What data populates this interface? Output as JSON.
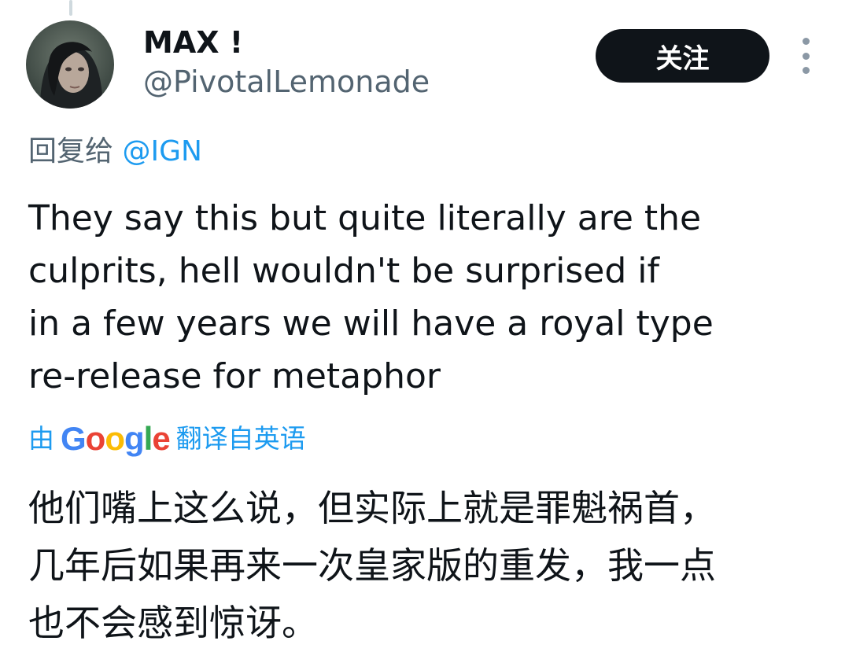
{
  "author": {
    "display_name": "MAX !",
    "handle": "@PivotalLemonade"
  },
  "actions": {
    "follow_label": "关注"
  },
  "reply_context": {
    "prefix": "回复给",
    "mention": "@IGN"
  },
  "tweet": {
    "lines": [
      "They say this but quite literally are the",
      "culprits, hell wouldn't be surprised if",
      "in a few years we will have a royal type",
      "re-release for metaphor"
    ]
  },
  "translation": {
    "by_prefix": "由",
    "provider_letters": [
      "G",
      "o",
      "o",
      "g",
      "l",
      "e"
    ],
    "by_suffix": "翻译自英语",
    "lines": [
      "他们嘴上这么说，但实际上就是罪魁祸首，",
      "几年后如果再来一次皇家版的重发，我一点",
      "也不会感到惊讶。"
    ]
  },
  "icons": {
    "more": "more-vertical-icon",
    "avatar": "user-avatar"
  },
  "colors": {
    "link_blue": "#1d9bf0",
    "secondary_text": "#536471",
    "follow_button_bg": "#0f1419",
    "google_blue": "#4285f4",
    "google_red": "#ea4335",
    "google_yellow": "#fbbc05",
    "google_green": "#34a853"
  }
}
